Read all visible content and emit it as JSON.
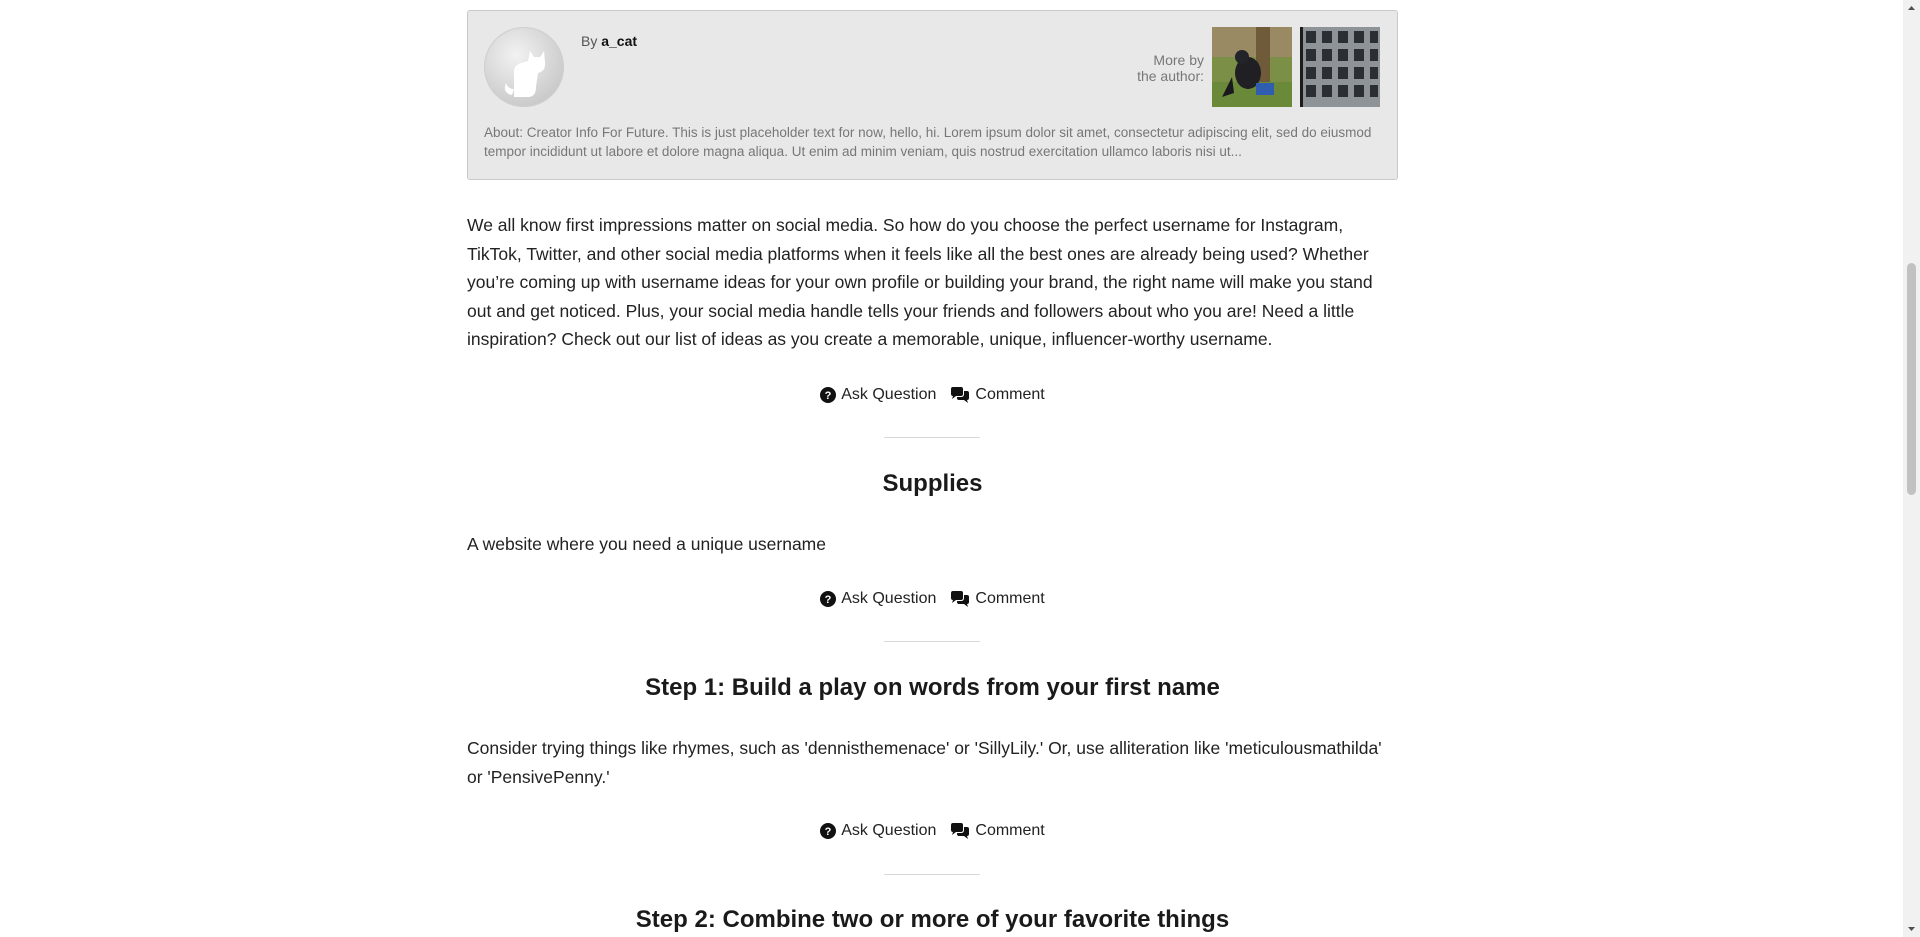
{
  "author": {
    "by_label": "By",
    "name": "a_cat",
    "more_by_label_line1": "More by",
    "more_by_label_line2": "the author:",
    "about": "About: Creator Info For Future. This is just placeholder text for now, hello, hi. Lorem ipsum dolor sit amet, consectetur adipiscing elit, sed do eiusmod tempor incididunt ut labore et dolore magna aliqua. Ut enim ad minim veniam, quis nostrud exercitation ullamco laboris nisi ut..."
  },
  "intro": {
    "text": "We all know first impressions matter on social media. So how do you choose the perfect username for Instagram, TikTok, Twitter, and other social media platforms when it feels like all the best ones are already being used? Whether you’re coming up with username ideas for your own profile or building your brand, the right name will make you stand out and get noticed. Plus, your social media handle tells your friends and followers about who you are! Need a little inspiration? Check out our list of ideas as you create a memorable, unique, influencer-worthy username."
  },
  "actions": {
    "ask_question": "Ask Question",
    "comment": "Comment"
  },
  "sections": [
    {
      "title": "Supplies",
      "text": "A website where you need a unique username"
    },
    {
      "title": "Step 1: Build a play on words from your first name",
      "text": "Consider trying things like rhymes, such as 'dennisthemenace' or 'SillyLily.' Or, use alliteration like 'meticulousmathilda' or 'PensivePenny.'"
    },
    {
      "title": "Step 2: Combine two or more of your favorite things"
    }
  ],
  "colors": {
    "text": "#222222",
    "author_box_bg": "#e8e8e8",
    "muted": "#777777"
  },
  "icons": {
    "ask": "question-circle-icon",
    "comment": "comments-icon"
  }
}
